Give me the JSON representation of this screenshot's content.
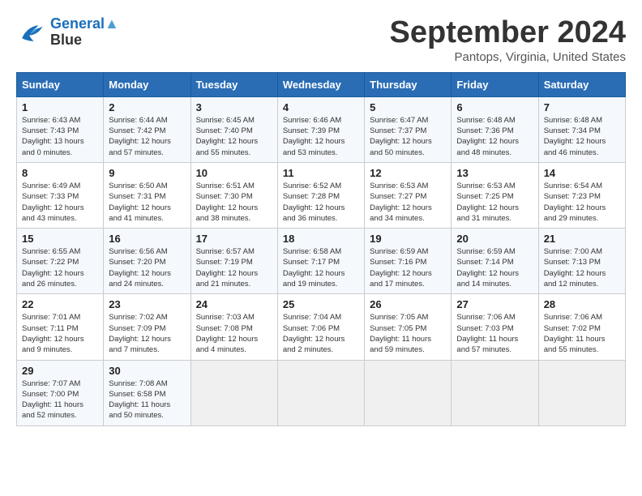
{
  "header": {
    "logo_line1": "General",
    "logo_line2": "Blue",
    "month": "September 2024",
    "location": "Pantops, Virginia, United States"
  },
  "days_of_week": [
    "Sunday",
    "Monday",
    "Tuesday",
    "Wednesday",
    "Thursday",
    "Friday",
    "Saturday"
  ],
  "weeks": [
    [
      {
        "day": "1",
        "info": "Sunrise: 6:43 AM\nSunset: 7:43 PM\nDaylight: 13 hours\nand 0 minutes."
      },
      {
        "day": "2",
        "info": "Sunrise: 6:44 AM\nSunset: 7:42 PM\nDaylight: 12 hours\nand 57 minutes."
      },
      {
        "day": "3",
        "info": "Sunrise: 6:45 AM\nSunset: 7:40 PM\nDaylight: 12 hours\nand 55 minutes."
      },
      {
        "day": "4",
        "info": "Sunrise: 6:46 AM\nSunset: 7:39 PM\nDaylight: 12 hours\nand 53 minutes."
      },
      {
        "day": "5",
        "info": "Sunrise: 6:47 AM\nSunset: 7:37 PM\nDaylight: 12 hours\nand 50 minutes."
      },
      {
        "day": "6",
        "info": "Sunrise: 6:48 AM\nSunset: 7:36 PM\nDaylight: 12 hours\nand 48 minutes."
      },
      {
        "day": "7",
        "info": "Sunrise: 6:48 AM\nSunset: 7:34 PM\nDaylight: 12 hours\nand 46 minutes."
      }
    ],
    [
      {
        "day": "8",
        "info": "Sunrise: 6:49 AM\nSunset: 7:33 PM\nDaylight: 12 hours\nand 43 minutes."
      },
      {
        "day": "9",
        "info": "Sunrise: 6:50 AM\nSunset: 7:31 PM\nDaylight: 12 hours\nand 41 minutes."
      },
      {
        "day": "10",
        "info": "Sunrise: 6:51 AM\nSunset: 7:30 PM\nDaylight: 12 hours\nand 38 minutes."
      },
      {
        "day": "11",
        "info": "Sunrise: 6:52 AM\nSunset: 7:28 PM\nDaylight: 12 hours\nand 36 minutes."
      },
      {
        "day": "12",
        "info": "Sunrise: 6:53 AM\nSunset: 7:27 PM\nDaylight: 12 hours\nand 34 minutes."
      },
      {
        "day": "13",
        "info": "Sunrise: 6:53 AM\nSunset: 7:25 PM\nDaylight: 12 hours\nand 31 minutes."
      },
      {
        "day": "14",
        "info": "Sunrise: 6:54 AM\nSunset: 7:23 PM\nDaylight: 12 hours\nand 29 minutes."
      }
    ],
    [
      {
        "day": "15",
        "info": "Sunrise: 6:55 AM\nSunset: 7:22 PM\nDaylight: 12 hours\nand 26 minutes."
      },
      {
        "day": "16",
        "info": "Sunrise: 6:56 AM\nSunset: 7:20 PM\nDaylight: 12 hours\nand 24 minutes."
      },
      {
        "day": "17",
        "info": "Sunrise: 6:57 AM\nSunset: 7:19 PM\nDaylight: 12 hours\nand 21 minutes."
      },
      {
        "day": "18",
        "info": "Sunrise: 6:58 AM\nSunset: 7:17 PM\nDaylight: 12 hours\nand 19 minutes."
      },
      {
        "day": "19",
        "info": "Sunrise: 6:59 AM\nSunset: 7:16 PM\nDaylight: 12 hours\nand 17 minutes."
      },
      {
        "day": "20",
        "info": "Sunrise: 6:59 AM\nSunset: 7:14 PM\nDaylight: 12 hours\nand 14 minutes."
      },
      {
        "day": "21",
        "info": "Sunrise: 7:00 AM\nSunset: 7:13 PM\nDaylight: 12 hours\nand 12 minutes."
      }
    ],
    [
      {
        "day": "22",
        "info": "Sunrise: 7:01 AM\nSunset: 7:11 PM\nDaylight: 12 hours\nand 9 minutes."
      },
      {
        "day": "23",
        "info": "Sunrise: 7:02 AM\nSunset: 7:09 PM\nDaylight: 12 hours\nand 7 minutes."
      },
      {
        "day": "24",
        "info": "Sunrise: 7:03 AM\nSunset: 7:08 PM\nDaylight: 12 hours\nand 4 minutes."
      },
      {
        "day": "25",
        "info": "Sunrise: 7:04 AM\nSunset: 7:06 PM\nDaylight: 12 hours\nand 2 minutes."
      },
      {
        "day": "26",
        "info": "Sunrise: 7:05 AM\nSunset: 7:05 PM\nDaylight: 11 hours\nand 59 minutes."
      },
      {
        "day": "27",
        "info": "Sunrise: 7:06 AM\nSunset: 7:03 PM\nDaylight: 11 hours\nand 57 minutes."
      },
      {
        "day": "28",
        "info": "Sunrise: 7:06 AM\nSunset: 7:02 PM\nDaylight: 11 hours\nand 55 minutes."
      }
    ],
    [
      {
        "day": "29",
        "info": "Sunrise: 7:07 AM\nSunset: 7:00 PM\nDaylight: 11 hours\nand 52 minutes."
      },
      {
        "day": "30",
        "info": "Sunrise: 7:08 AM\nSunset: 6:58 PM\nDaylight: 11 hours\nand 50 minutes."
      },
      {
        "day": "",
        "info": ""
      },
      {
        "day": "",
        "info": ""
      },
      {
        "day": "",
        "info": ""
      },
      {
        "day": "",
        "info": ""
      },
      {
        "day": "",
        "info": ""
      }
    ]
  ]
}
